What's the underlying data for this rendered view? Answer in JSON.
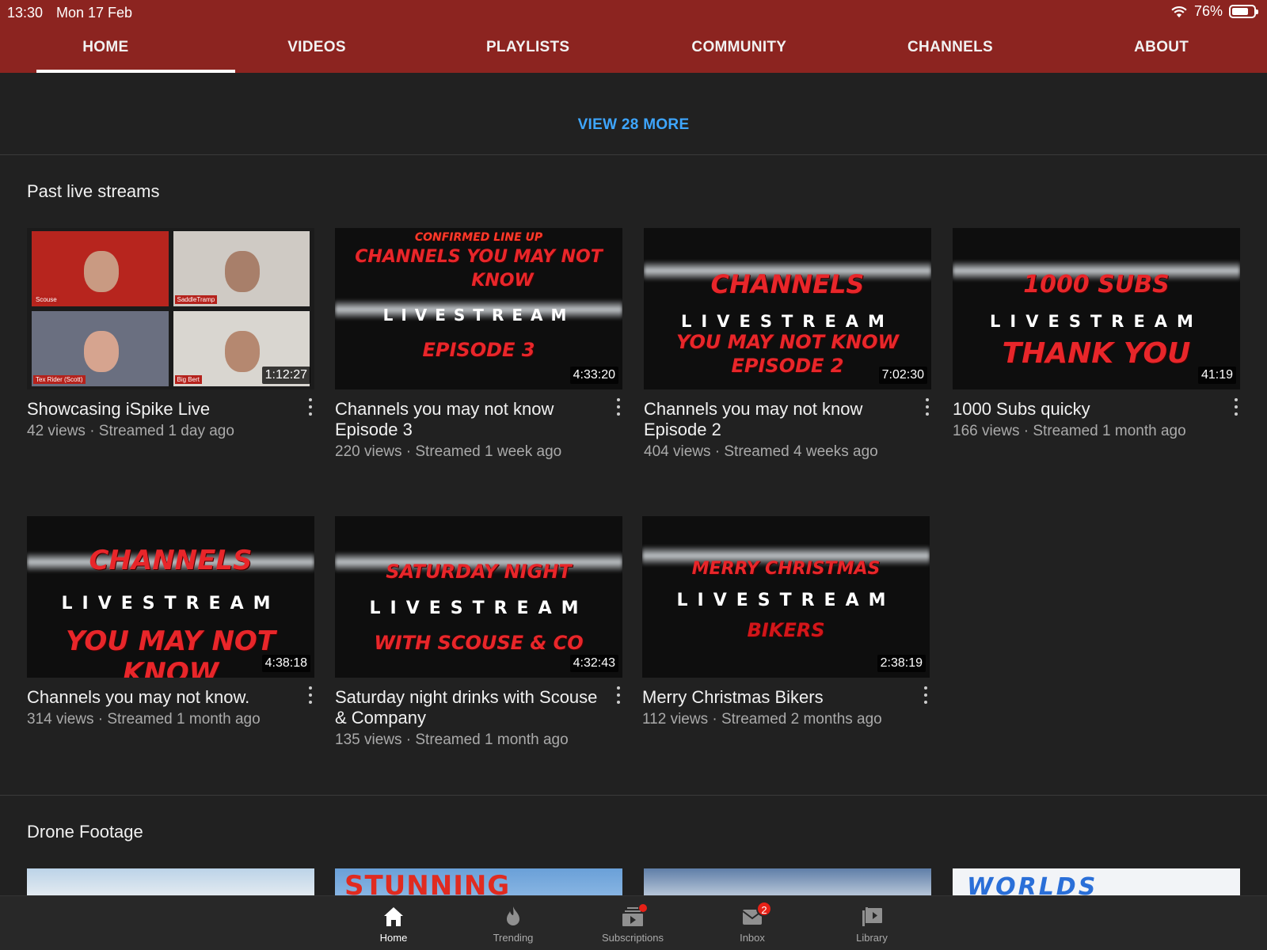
{
  "status_bar": {
    "time": "13:30",
    "date": "Mon 17 Feb",
    "battery": "76%"
  },
  "tabs": [
    {
      "label": "HOME",
      "active": true
    },
    {
      "label": "VIDEOS"
    },
    {
      "label": "PLAYLISTS"
    },
    {
      "label": "COMMUNITY"
    },
    {
      "label": "CHANNELS"
    },
    {
      "label": "ABOUT"
    }
  ],
  "view_more": "VIEW 28 MORE",
  "sections": {
    "live": {
      "title": "Past live streams",
      "videos": [
        {
          "title": "Showcasing iSpike Live",
          "meta": "42 views · Streamed 1 day ago",
          "duration": "1:12:27",
          "thumb": {
            "tags": [
              "Scouse",
              "SaddleTramp",
              "Tex Rider (Scott)",
              "Big Bert"
            ]
          }
        },
        {
          "title": "Channels you may not know Episode 3",
          "meta": "220 views · Streamed 1 week ago",
          "duration": "4:33:20",
          "thumb": {
            "top": "CONFIRMED LINE UP",
            "line1": "CHANNELS YOU MAY NOT",
            "line2": "KNOW",
            "mid": "LIVESTREAM",
            "line3": "EPISODE 3"
          }
        },
        {
          "title": "Channels you may not know Episode 2",
          "meta": "404 views · Streamed 4 weeks ago",
          "duration": "7:02:30",
          "thumb": {
            "line1": "CHANNELS",
            "mid": "LIVESTREAM",
            "line2": "YOU MAY NOT KNOW",
            "line3": "EPISODE 2"
          }
        },
        {
          "title": "1000 Subs quicky",
          "meta": "166 views · Streamed 1 month ago",
          "duration": "41:19",
          "thumb": {
            "line1": "1000 SUBS",
            "mid": "LIVESTREAM",
            "line2": "THANK YOU"
          }
        },
        {
          "title": "Channels you may not know.",
          "meta": "314 views · Streamed 1 month ago",
          "duration": "4:38:18",
          "thumb": {
            "line1": "CHANNELS",
            "mid": "LIVESTREAM",
            "line2": "YOU MAY NOT KNOW"
          }
        },
        {
          "title": "Saturday night drinks with Scouse & Company",
          "meta": "135 views · Streamed 1 month ago",
          "duration": "4:32:43",
          "thumb": {
            "line1": "SATURDAY NIGHT",
            "mid": "LIVESTREAM",
            "line2": "WITH SCOUSE & CO"
          }
        },
        {
          "title": "Merry Christmas Bikers",
          "meta": "112 views · Streamed 2 months ago",
          "duration": "2:38:19",
          "thumb": {
            "line1": "MERRY CHRISTMAS",
            "mid": "LIVESTREAM",
            "line2": "BIKERS"
          }
        }
      ]
    },
    "drone": {
      "title": "Drone Footage",
      "thumbs": [
        "",
        "STUNNING",
        "",
        "WORLDS BIGGEST"
      ]
    }
  },
  "bottom_nav": [
    {
      "label": "Home",
      "icon": "home-icon",
      "active": true
    },
    {
      "label": "Trending",
      "icon": "flame-icon"
    },
    {
      "label": "Subscriptions",
      "icon": "subscriptions-icon"
    },
    {
      "label": "Inbox",
      "icon": "inbox-icon",
      "badge": "2"
    },
    {
      "label": "Library",
      "icon": "library-icon"
    }
  ],
  "colors": {
    "header": "#8c2420",
    "background": "#212121",
    "link": "#3ea6ff",
    "badge": "#e62117"
  }
}
